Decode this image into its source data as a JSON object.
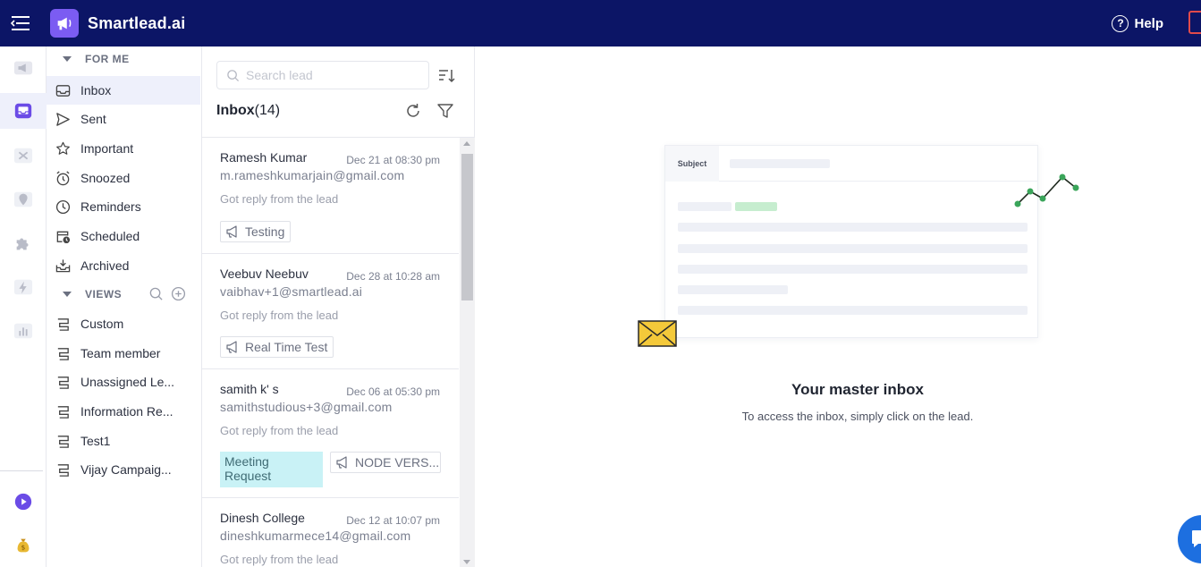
{
  "app": {
    "brand": "Smartlead.ai",
    "help_label": "Help",
    "colors": {
      "topbar": "#0c1566",
      "accent": "#7b5cf2",
      "meeting_tag": "#c9f2f6"
    }
  },
  "rail": {
    "icons": [
      "megaphone-icon",
      "inbox-icon",
      "crossed-tools-icon",
      "map-pin-icon",
      "puzzle-icon",
      "bolt-icon",
      "bar-chart-icon",
      "play-circle-icon",
      "money-bag-icon"
    ]
  },
  "sidebar": {
    "for_me_label": "FOR ME",
    "views_label": "VIEWS",
    "folders": [
      {
        "label": "Inbox",
        "icon": "inbox-icon"
      },
      {
        "label": "Sent",
        "icon": "send-icon"
      },
      {
        "label": "Important",
        "icon": "star-icon"
      },
      {
        "label": "Snoozed",
        "icon": "alarm-clock-icon"
      },
      {
        "label": "Reminders",
        "icon": "clock-icon"
      },
      {
        "label": "Scheduled",
        "icon": "calendar-clock-icon"
      },
      {
        "label": "Archived",
        "icon": "archive-icon"
      }
    ],
    "views": [
      {
        "label": "Custom"
      },
      {
        "label": "Team member"
      },
      {
        "label": "Unassigned Le..."
      },
      {
        "label": "Information Re..."
      },
      {
        "label": "Test1"
      },
      {
        "label": "Vijay Campaig..."
      }
    ]
  },
  "leadlist": {
    "search_placeholder": "Search lead",
    "title": "Inbox",
    "count": "(14)",
    "leads": [
      {
        "name": "Ramesh Kumar",
        "date": "Dec 21 at 08:30 pm",
        "email": "m.rameshkumarjain@gmail.com",
        "preview": "Got reply from the lead",
        "campaign_tag": "Testing"
      },
      {
        "name": "Veebuv Neebuv",
        "date": "Dec 28 at 10:28 am",
        "email": "vaibhav+1@smartlead.ai",
        "preview": "Got reply from the lead",
        "campaign_tag": "Real Time Test"
      },
      {
        "name": "samith k' s",
        "date": "Dec 06 at 05:30 pm",
        "email": "samithstudious+3@gmail.com",
        "preview": "Got reply from the lead",
        "status_tag": "Meeting Request",
        "campaign_tag": "NODE VERS..."
      },
      {
        "name": "Dinesh College",
        "date": "Dec 12 at 10:07 pm",
        "email": "dineshkumarmece14@gmail.com",
        "preview": "Got reply from the lead"
      }
    ]
  },
  "empty_state": {
    "subject_label": "Subject",
    "title": "Your master inbox",
    "subtitle": "To access the inbox, simply click on the lead."
  }
}
